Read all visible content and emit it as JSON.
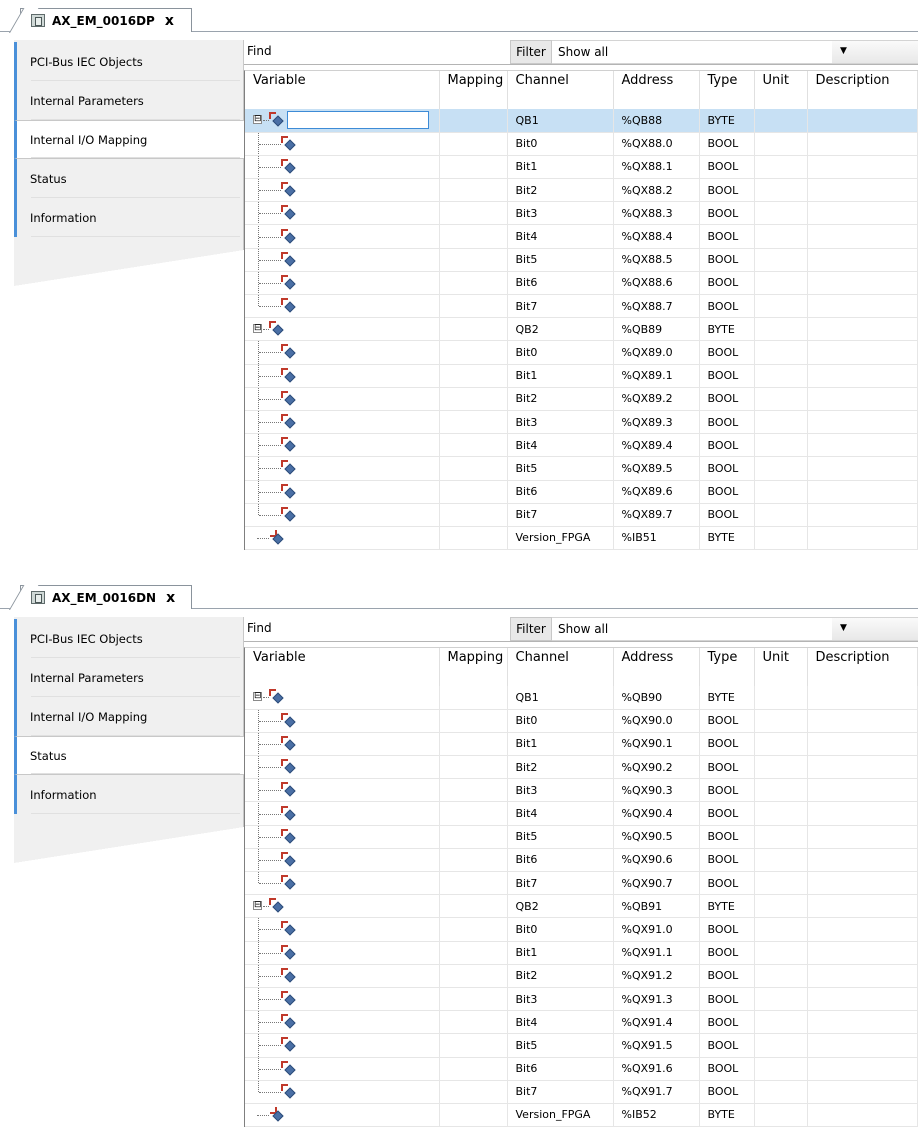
{
  "panels": [
    {
      "tab": {
        "title": "AX_EM_0016DP",
        "close": "x"
      },
      "nav": [
        "PCI-Bus IEC Objects",
        "Internal Parameters",
        "Internal I/O Mapping",
        "Status",
        "Information"
      ],
      "active_nav": 2,
      "find_label": "Find",
      "filter_label": "Filter",
      "filter_value": "Show all",
      "columns": [
        "Variable",
        "Mapping",
        "Channel",
        "Address",
        "Type",
        "Unit",
        "Description"
      ],
      "rows": [
        {
          "level": 0,
          "expander": "⊟",
          "channel": "QB1",
          "address": "%QB88",
          "type": "BYTE",
          "selected": true
        },
        {
          "level": 1,
          "channel": "Bit0",
          "address": "%QX88.0",
          "type": "BOOL"
        },
        {
          "level": 1,
          "channel": "Bit1",
          "address": "%QX88.1",
          "type": "BOOL"
        },
        {
          "level": 1,
          "channel": "Bit2",
          "address": "%QX88.2",
          "type": "BOOL"
        },
        {
          "level": 1,
          "channel": "Bit3",
          "address": "%QX88.3",
          "type": "BOOL"
        },
        {
          "level": 1,
          "channel": "Bit4",
          "address": "%QX88.4",
          "type": "BOOL"
        },
        {
          "level": 1,
          "channel": "Bit5",
          "address": "%QX88.5",
          "type": "BOOL"
        },
        {
          "level": 1,
          "channel": "Bit6",
          "address": "%QX88.6",
          "type": "BOOL"
        },
        {
          "level": 1,
          "channel": "Bit7",
          "address": "%QX88.7",
          "type": "BOOL",
          "last": true
        },
        {
          "level": 0,
          "expander": "⊟",
          "channel": "QB2",
          "address": "%QB89",
          "type": "BYTE"
        },
        {
          "level": 1,
          "channel": "Bit0",
          "address": "%QX89.0",
          "type": "BOOL"
        },
        {
          "level": 1,
          "channel": "Bit1",
          "address": "%QX89.1",
          "type": "BOOL"
        },
        {
          "level": 1,
          "channel": "Bit2",
          "address": "%QX89.2",
          "type": "BOOL"
        },
        {
          "level": 1,
          "channel": "Bit3",
          "address": "%QX89.3",
          "type": "BOOL"
        },
        {
          "level": 1,
          "channel": "Bit4",
          "address": "%QX89.4",
          "type": "BOOL"
        },
        {
          "level": 1,
          "channel": "Bit5",
          "address": "%QX89.5",
          "type": "BOOL"
        },
        {
          "level": 1,
          "channel": "Bit6",
          "address": "%QX89.6",
          "type": "BOOL"
        },
        {
          "level": 1,
          "channel": "Bit7",
          "address": "%QX89.7",
          "type": "BOOL",
          "last": true
        },
        {
          "level": 0,
          "input": true,
          "channel": "Version_FPGA",
          "address": "%IB51",
          "type": "BYTE"
        }
      ]
    },
    {
      "tab": {
        "title": "AX_EM_0016DN",
        "close": "x"
      },
      "nav": [
        "PCI-Bus IEC Objects",
        "Internal Parameters",
        "Internal I/O Mapping",
        "Status",
        "Information"
      ],
      "active_nav": 3,
      "find_label": "Find",
      "filter_label": "Filter",
      "filter_value": "Show all",
      "columns": [
        "Variable",
        "Mapping",
        "Channel",
        "Address",
        "Type",
        "Unit",
        "Description"
      ],
      "rows": [
        {
          "level": 0,
          "expander": "⊟",
          "channel": "QB1",
          "address": "%QB90",
          "type": "BYTE"
        },
        {
          "level": 1,
          "channel": "Bit0",
          "address": "%QX90.0",
          "type": "BOOL"
        },
        {
          "level": 1,
          "channel": "Bit1",
          "address": "%QX90.1",
          "type": "BOOL"
        },
        {
          "level": 1,
          "channel": "Bit2",
          "address": "%QX90.2",
          "type": "BOOL"
        },
        {
          "level": 1,
          "channel": "Bit3",
          "address": "%QX90.3",
          "type": "BOOL"
        },
        {
          "level": 1,
          "channel": "Bit4",
          "address": "%QX90.4",
          "type": "BOOL"
        },
        {
          "level": 1,
          "channel": "Bit5",
          "address": "%QX90.5",
          "type": "BOOL"
        },
        {
          "level": 1,
          "channel": "Bit6",
          "address": "%QX90.6",
          "type": "BOOL"
        },
        {
          "level": 1,
          "channel": "Bit7",
          "address": "%QX90.7",
          "type": "BOOL",
          "last": true
        },
        {
          "level": 0,
          "expander": "⊟",
          "channel": "QB2",
          "address": "%QB91",
          "type": "BYTE"
        },
        {
          "level": 1,
          "channel": "Bit0",
          "address": "%QX91.0",
          "type": "BOOL"
        },
        {
          "level": 1,
          "channel": "Bit1",
          "address": "%QX91.1",
          "type": "BOOL"
        },
        {
          "level": 1,
          "channel": "Bit2",
          "address": "%QX91.2",
          "type": "BOOL"
        },
        {
          "level": 1,
          "channel": "Bit3",
          "address": "%QX91.3",
          "type": "BOOL"
        },
        {
          "level": 1,
          "channel": "Bit4",
          "address": "%QX91.4",
          "type": "BOOL"
        },
        {
          "level": 1,
          "channel": "Bit5",
          "address": "%QX91.5",
          "type": "BOOL"
        },
        {
          "level": 1,
          "channel": "Bit6",
          "address": "%QX91.6",
          "type": "BOOL"
        },
        {
          "level": 1,
          "channel": "Bit7",
          "address": "%QX91.7",
          "type": "BOOL",
          "last": true
        },
        {
          "level": 0,
          "input": true,
          "channel": "Version_FPGA",
          "address": "%IB52",
          "type": "BYTE"
        }
      ]
    }
  ],
  "colors": {
    "accent": "#4a90d9",
    "selection": "#c7e0f4"
  }
}
